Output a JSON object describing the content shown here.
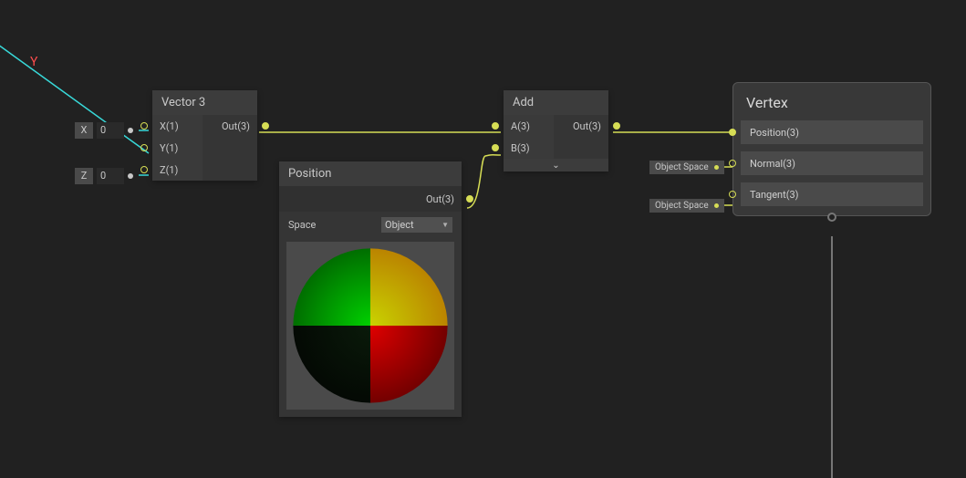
{
  "graph": {
    "y_axis_label": "Y"
  },
  "ext_inputs": {
    "x": {
      "label": "X",
      "value": "0"
    },
    "z": {
      "label": "Z",
      "value": "0"
    }
  },
  "vector3": {
    "title": "Vector 3",
    "in": {
      "x": "X(1)",
      "y": "Y(1)",
      "z": "Z(1)"
    },
    "out": "Out(3)"
  },
  "position": {
    "title": "Position",
    "out": "Out(3)",
    "space_label": "Space",
    "space_value": "Object"
  },
  "add": {
    "title": "Add",
    "in": {
      "a": "A(3)",
      "b": "B(3)"
    },
    "out": "Out(3)"
  },
  "vertex": {
    "title": "Vertex",
    "rows": {
      "position": "Position(3)",
      "normal": "Normal(3)",
      "tangent": "Tangent(3)"
    },
    "tags": {
      "normal_space": "Object Space",
      "tangent_space": "Object Space"
    }
  },
  "colors": {
    "wire_connected": "#d6dd55",
    "wire_unconnected": "#38d9d9"
  }
}
